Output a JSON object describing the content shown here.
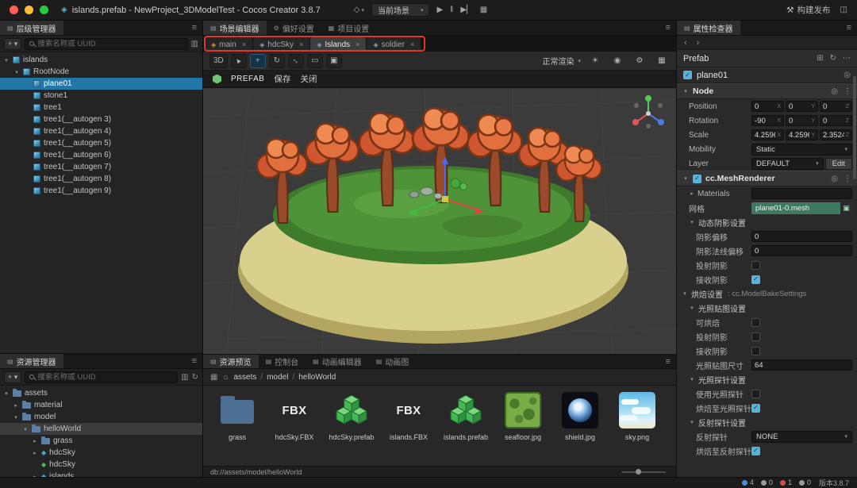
{
  "titlebar": {
    "title": "islands.prefab - NewProject_3DModelTest - Cocos Creator 3.8.7",
    "scene_select": "当前场景",
    "build": "构建发布"
  },
  "hierarchy": {
    "tab": "层级管理器",
    "search_placeholder": "搜索名称或 UUID",
    "items": [
      {
        "label": "islands",
        "depth": 0,
        "expand": "open"
      },
      {
        "label": "RootNode",
        "depth": 1,
        "expand": "open"
      },
      {
        "label": "plane01",
        "depth": 2,
        "selected": true
      },
      {
        "label": "stone1",
        "depth": 2
      },
      {
        "label": "tree1",
        "depth": 2
      },
      {
        "label": "tree1(__autogen 3)",
        "depth": 2
      },
      {
        "label": "tree1(__autogen 4)",
        "depth": 2
      },
      {
        "label": "tree1(__autogen 5)",
        "depth": 2
      },
      {
        "label": "tree1(__autogen 6)",
        "depth": 2
      },
      {
        "label": "tree1(__autogen 7)",
        "depth": 2
      },
      {
        "label": "tree1(__autogen 8)",
        "depth": 2
      },
      {
        "label": "tree1(__autogen 9)",
        "depth": 2
      }
    ]
  },
  "assets_panel": {
    "tab": "资源管理器",
    "search_placeholder": "搜索名称或 UUID",
    "items": [
      {
        "label": "assets",
        "depth": 0,
        "expand": "open",
        "icon": "folder"
      },
      {
        "label": "material",
        "depth": 1,
        "expand": "closed",
        "icon": "folder"
      },
      {
        "label": "model",
        "depth": 1,
        "expand": "open",
        "icon": "folder"
      },
      {
        "label": "helloWorld",
        "depth": 2,
        "expand": "open",
        "icon": "folder",
        "selected": true
      },
      {
        "label": "grass",
        "depth": 3,
        "expand": "closed",
        "icon": "folder"
      },
      {
        "label": "hdcSky",
        "depth": 3,
        "expand": "closed",
        "icon": "fbx"
      },
      {
        "label": "hdcSky",
        "depth": 3,
        "expand": "none",
        "icon": "prefab"
      },
      {
        "label": "islands",
        "depth": 3,
        "expand": "closed",
        "icon": "fbx"
      }
    ]
  },
  "scene": {
    "tabs": [
      {
        "label": "场景编辑器",
        "active": true
      },
      {
        "label": "偏好设置"
      },
      {
        "label": "项目设置"
      }
    ],
    "doc_tabs": [
      {
        "label": "main",
        "closable": true
      },
      {
        "label": "hdcSky",
        "closable": true
      },
      {
        "label": "Islands",
        "active": true,
        "closable": true
      },
      {
        "label": "soldier",
        "closable": true
      }
    ],
    "toolbar": {
      "mode_label": "3D",
      "render_mode": "正常渲染"
    },
    "prefab_bar": {
      "badge": "PREFAB",
      "save": "保存",
      "close": "关闭"
    }
  },
  "preview": {
    "tabs": [
      {
        "label": "资源预览",
        "active": true
      },
      {
        "label": "控制台"
      },
      {
        "label": "动画编辑器"
      },
      {
        "label": "动画图"
      }
    ],
    "breadcrumb": [
      "assets",
      "model",
      "helloWorld"
    ],
    "grid": [
      {
        "label": "grass",
        "type": "folder"
      },
      {
        "label": "hdcSky.FBX",
        "type": "fbx",
        "icon_text": "FBX"
      },
      {
        "label": "hdcSky.prefab",
        "type": "prefab"
      },
      {
        "label": "islands.FBX",
        "type": "fbx",
        "icon_text": "FBX"
      },
      {
        "label": "islands.prefab",
        "type": "prefab"
      },
      {
        "label": "seafloor.jpg",
        "type": "img_seafloor"
      },
      {
        "label": "shield.jpg",
        "type": "img_shield"
      },
      {
        "label": "sky.png",
        "type": "img_sky"
      }
    ],
    "status_path": "db://assets/model/helloWorld"
  },
  "inspector": {
    "tab": "属性检查器",
    "prefab_label": "Prefab",
    "node_name": "plane01",
    "rows": [
      {
        "type": "comp",
        "title": "Node"
      },
      {
        "type": "vec3",
        "label": "Position",
        "values": [
          "0",
          "0",
          "0"
        ],
        "indent": 1
      },
      {
        "type": "vec3",
        "label": "Rotation",
        "values": [
          "-90",
          "0",
          "0"
        ],
        "indent": 1
      },
      {
        "type": "vec3",
        "label": "Scale",
        "values": [
          "4.2596",
          "4.2596",
          "2.3524"
        ],
        "indent": 1
      },
      {
        "type": "select",
        "label": "Mobility",
        "value": "Static",
        "indent": 1
      },
      {
        "type": "select_edit",
        "label": "Layer",
        "value": "DEFAULT",
        "button": "Edit",
        "indent": 1
      },
      {
        "type": "comp",
        "title": "cc.MeshRenderer",
        "checkbox": true
      },
      {
        "type": "array",
        "label": "Materials",
        "indent": 1
      },
      {
        "type": "asset",
        "label": "网格",
        "value": "plane01-0.mesh",
        "indent": 1
      },
      {
        "type": "group",
        "label": "动态阴影设置",
        "indent": 1
      },
      {
        "type": "input",
        "label": "阴影偏移",
        "value": "0",
        "indent": 2
      },
      {
        "type": "input",
        "label": "阴影法线偏移",
        "value": "0",
        "indent": 2
      },
      {
        "type": "check",
        "label": "投射阴影",
        "checked": false,
        "indent": 2
      },
      {
        "type": "check",
        "label": "接收阴影",
        "checked": true,
        "indent": 2
      },
      {
        "type": "bake",
        "label": "烘焙设置",
        "suffix": ": cc.ModelBakeSettings",
        "indent": 0
      },
      {
        "type": "group",
        "label": "光照贴图设置",
        "indent": 1
      },
      {
        "type": "check",
        "label": "可烘焙",
        "checked": false,
        "indent": 2
      },
      {
        "type": "check",
        "label": "投射阴影",
        "checked": false,
        "indent": 2
      },
      {
        "type": "check",
        "label": "接收阴影",
        "checked": false,
        "indent": 2
      },
      {
        "type": "input",
        "label": "光照贴图尺寸",
        "value": "64",
        "indent": 2
      },
      {
        "type": "group",
        "label": "光照探针设置",
        "indent": 1
      },
      {
        "type": "check",
        "label": "使用光照探针",
        "checked": false,
        "indent": 2
      },
      {
        "type": "check",
        "label": "烘焙至光照探针",
        "checked": true,
        "indent": 2
      },
      {
        "type": "group",
        "label": "反射探针设置",
        "indent": 1
      },
      {
        "type": "select",
        "label": "反射探针",
        "value": "NONE",
        "indent": 2
      },
      {
        "type": "check",
        "label": "烘焙至反射探针",
        "checked": true,
        "indent": 2
      }
    ]
  },
  "statusbar": {
    "counters": [
      {
        "label": "4",
        "color": "#4a90d9"
      },
      {
        "label": "0",
        "color": "#9a9a9a"
      },
      {
        "label": "1",
        "color": "#d05050"
      },
      {
        "label": "0",
        "color": "#9a9a9a"
      }
    ],
    "version": "版本3.8.7"
  },
  "colors": {
    "selection": "#2377a6",
    "annotation_box": "#e0372b",
    "prefab_badge": "#74c278"
  }
}
